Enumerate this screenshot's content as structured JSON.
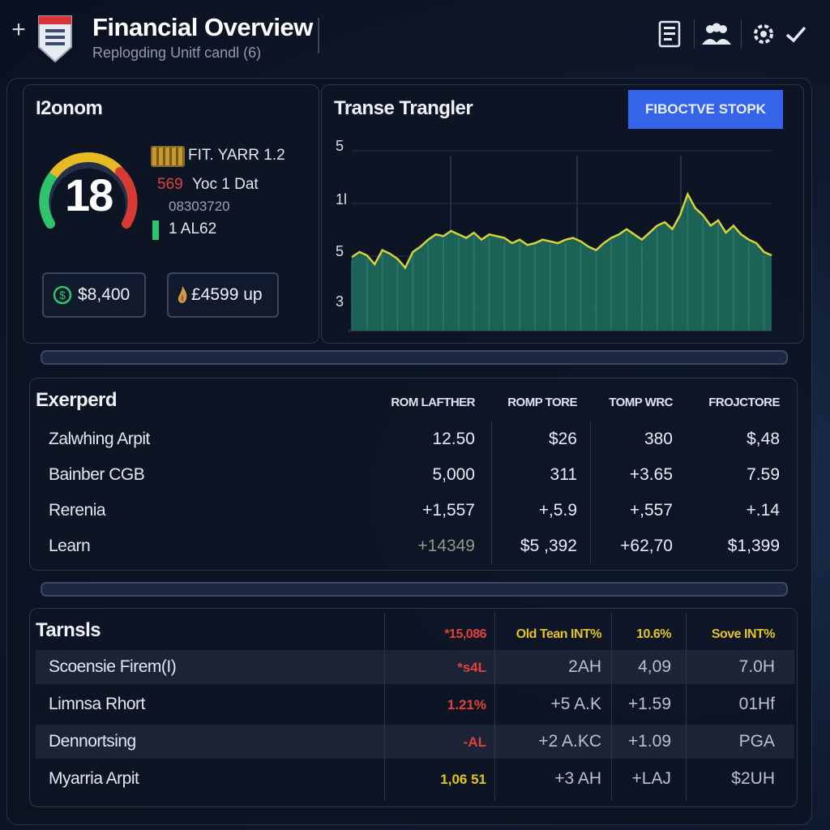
{
  "header": {
    "title": "Financial Overview",
    "subtitle": "Replogding Unitf candl (6)"
  },
  "gauge_panel": {
    "title": "I2onom",
    "gauge_value": "18",
    "gauge_level": 0.72,
    "line1": "FIT. YARR 1.2",
    "line2_red": "569",
    "line2_rest": "Yoc 1 Dat",
    "line3": "08303720",
    "line4": "1 AL62",
    "pill_left": "$8,400",
    "pill_right": "£4599 up"
  },
  "trend_panel": {
    "title": "Transe Trangler",
    "button": "FIBOCTVE STOPK",
    "y_ticks": [
      "5",
      "1l",
      "5",
      "3"
    ]
  },
  "chart_data": {
    "type": "area",
    "title": "Transe Trangler",
    "y_tick_labels": [
      "5",
      "1l",
      "5",
      "3"
    ],
    "values": [
      0.42,
      0.45,
      0.43,
      0.38,
      0.46,
      0.44,
      0.41,
      0.36,
      0.45,
      0.48,
      0.52,
      0.55,
      0.54,
      0.57,
      0.55,
      0.53,
      0.56,
      0.52,
      0.55,
      0.54,
      0.53,
      0.5,
      0.52,
      0.49,
      0.5,
      0.52,
      0.51,
      0.5,
      0.52,
      0.53,
      0.51,
      0.48,
      0.46,
      0.5,
      0.53,
      0.55,
      0.58,
      0.55,
      0.52,
      0.56,
      0.6,
      0.62,
      0.58,
      0.66,
      0.78,
      0.7,
      0.66,
      0.6,
      0.63,
      0.56,
      0.6,
      0.55,
      0.52,
      0.5,
      0.45,
      0.43
    ]
  },
  "expense_table": {
    "title": "Exerperd",
    "headers": [
      "ROM LAFTHER",
      "ROMP TORE",
      "TOMP WRC",
      "FROJCTORE"
    ],
    "rows": [
      {
        "label": "Zalwhing Arpit",
        "c1": "12.50",
        "c2": "$26",
        "c3": "380",
        "c4": "$,48"
      },
      {
        "label": "Bainber CGB",
        "c1": "5,000",
        "c2": "311",
        "c3": "+3.65",
        "c4": "7.59"
      },
      {
        "label": "Rerenia",
        "c1": "+1,557",
        "c2": "+,5.9",
        "c3": "+,557",
        "c4": "+.14"
      },
      {
        "label": "Learn",
        "c1": "+14349",
        "c2": "$5 ,392",
        "c3": "+62,70",
        "c4": "$1,399"
      }
    ]
  },
  "trends_table": {
    "title": "Tarnsls",
    "headers": [
      "*15,086",
      "Old Tean INT%",
      "10.6%",
      "Sove INT%"
    ],
    "header_colors": [
      "#e0413b",
      "#e3c420",
      "#e3c420",
      "#e3c420"
    ],
    "rows": [
      {
        "label": "Scoensie Firem(I)",
        "c1": "*s4L",
        "c2": "2AH",
        "c3": "4,09",
        "c4": "7.0H"
      },
      {
        "label": "Limnsa Rhort",
        "c1": "1.21%",
        "c2": "+5 A.K",
        "c3": "+1.59",
        "c4": "01Hf"
      },
      {
        "label": "Dennortsing",
        "c1": "-AL",
        "c2": "+2 A.KC",
        "c3": "+1.09",
        "c4": "PGA"
      },
      {
        "label": "Myarria Arpit",
        "c1": "1,06 51",
        "c2": "+3 AH",
        "c3": "+LAJ",
        "c4": "$2UH"
      }
    ],
    "c1_colors": [
      "#e0413b",
      "#e0413b",
      "#e0413b",
      "#e3c420"
    ]
  },
  "colors": {
    "accent": "#3563e9",
    "chart_fill": "#1f6a5c",
    "chart_line": "#d6d23a",
    "red": "#e0413b",
    "yellow": "#e3c420",
    "green": "#2ec46b"
  },
  "icons": [
    "plus-icon",
    "shield-logo-icon",
    "document-icon",
    "team-icon",
    "gear-icon",
    "check-icon",
    "dollar-coin-icon",
    "flame-icon"
  ]
}
